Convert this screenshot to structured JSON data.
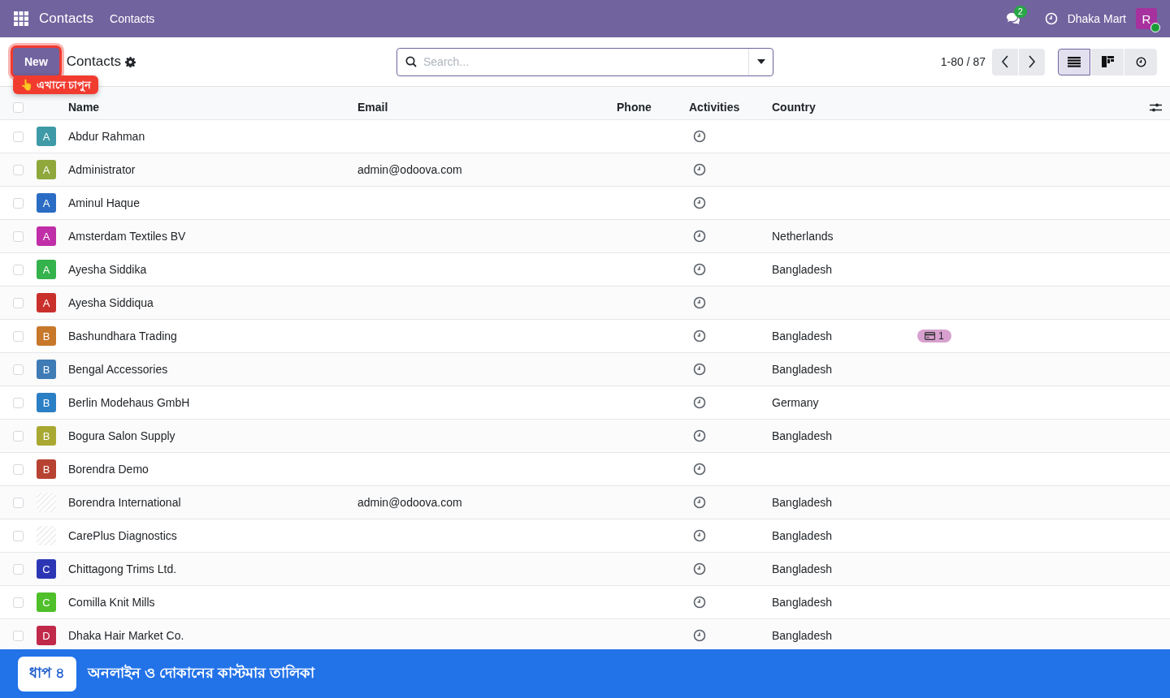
{
  "navbar": {
    "app_name": "Contacts",
    "menu": [
      "Contacts"
    ],
    "messages_count": "2",
    "company": "Dhaka Mart",
    "user_initial": "R",
    "user_online": true
  },
  "control_panel": {
    "new_button": "New",
    "breadcrumb": "Contacts",
    "search": {
      "placeholder": "Search..."
    },
    "pager": "1-80 / 87",
    "views": [
      {
        "kind": "list",
        "selected": true
      },
      {
        "kind": "kanban",
        "selected": false
      },
      {
        "kind": "activity",
        "selected": false
      }
    ]
  },
  "tooltip": "👆 এখানে চাপুন",
  "table": {
    "select_all": {
      "checked": false
    },
    "columns": [
      "Name",
      "Email",
      "Phone",
      "Activities",
      "Country"
    ],
    "rows": [
      {
        "checked": false,
        "avatar": {
          "kind": "letter",
          "letter": "A",
          "color": "#3e9aa6"
        },
        "name": "Abdur Rahman",
        "email": "",
        "country": ""
      },
      {
        "checked": false,
        "avatar": {
          "kind": "letter",
          "letter": "A",
          "color": "#8fa83c"
        },
        "name": "Administrator",
        "email": "admin@odoova.com",
        "country": ""
      },
      {
        "checked": false,
        "avatar": {
          "kind": "letter",
          "letter": "A",
          "color": "#2b6cc4"
        },
        "name": "Aminul Haque",
        "email": "",
        "country": ""
      },
      {
        "checked": false,
        "avatar": {
          "kind": "letter",
          "letter": "A",
          "color": "#c02ea8"
        },
        "name": "Amsterdam Textiles BV",
        "email": "",
        "country": "Netherlands"
      },
      {
        "checked": false,
        "avatar": {
          "kind": "letter",
          "letter": "A",
          "color": "#34b24c"
        },
        "name": "Ayesha Siddika",
        "email": "",
        "country": "Bangladesh"
      },
      {
        "checked": false,
        "avatar": {
          "kind": "letter",
          "letter": "A",
          "color": "#c9302c"
        },
        "name": "Ayesha Siddiqua",
        "email": "",
        "country": ""
      },
      {
        "checked": false,
        "avatar": {
          "kind": "letter",
          "letter": "B",
          "color": "#c8782a"
        },
        "name": "Bashundhara Trading",
        "email": "",
        "country": "Bangladesh",
        "column_6": "1"
      },
      {
        "checked": false,
        "avatar": {
          "kind": "letter",
          "letter": "B",
          "color": "#3f7bb5"
        },
        "name": "Bengal Accessories",
        "email": "",
        "country": "Bangladesh"
      },
      {
        "checked": false,
        "avatar": {
          "kind": "letter",
          "letter": "B",
          "color": "#2b7fc4"
        },
        "name": "Berlin Modehaus GmbH",
        "email": "",
        "country": "Germany"
      },
      {
        "checked": false,
        "avatar": {
          "kind": "letter",
          "letter": "B",
          "color": "#a8a832"
        },
        "name": "Bogura Salon Supply",
        "email": "",
        "country": "Bangladesh"
      },
      {
        "checked": false,
        "avatar": {
          "kind": "letter",
          "letter": "B",
          "color": "#b84232"
        },
        "name": "Borendra Demo",
        "email": "",
        "country": ""
      },
      {
        "checked": false,
        "avatar": {
          "kind": "logo"
        },
        "name": "Borendra International",
        "email": "admin@odoova.com",
        "country": "Bangladesh"
      },
      {
        "checked": false,
        "avatar": {
          "kind": "logo"
        },
        "name": "CarePlus Diagnostics",
        "email": "",
        "country": "Bangladesh"
      },
      {
        "checked": false,
        "avatar": {
          "kind": "letter",
          "letter": "C",
          "color": "#2c36b5"
        },
        "name": "Chittagong Trims Ltd.",
        "email": "",
        "country": "Bangladesh"
      },
      {
        "checked": false,
        "avatar": {
          "kind": "letter",
          "letter": "C",
          "color": "#4fbf2a"
        },
        "name": "Comilla Knit Mills",
        "email": "",
        "country": "Bangladesh"
      },
      {
        "checked": false,
        "avatar": {
          "kind": "letter",
          "letter": "D",
          "color": "#c0294a"
        },
        "name": "Dhaka Hair Market Co.",
        "email": "",
        "country": "Bangladesh"
      }
    ]
  },
  "banner": {
    "step": "ধাপ ৪",
    "text": "অনলাইন ও দোকানের কাস্টমার তালিকা"
  }
}
